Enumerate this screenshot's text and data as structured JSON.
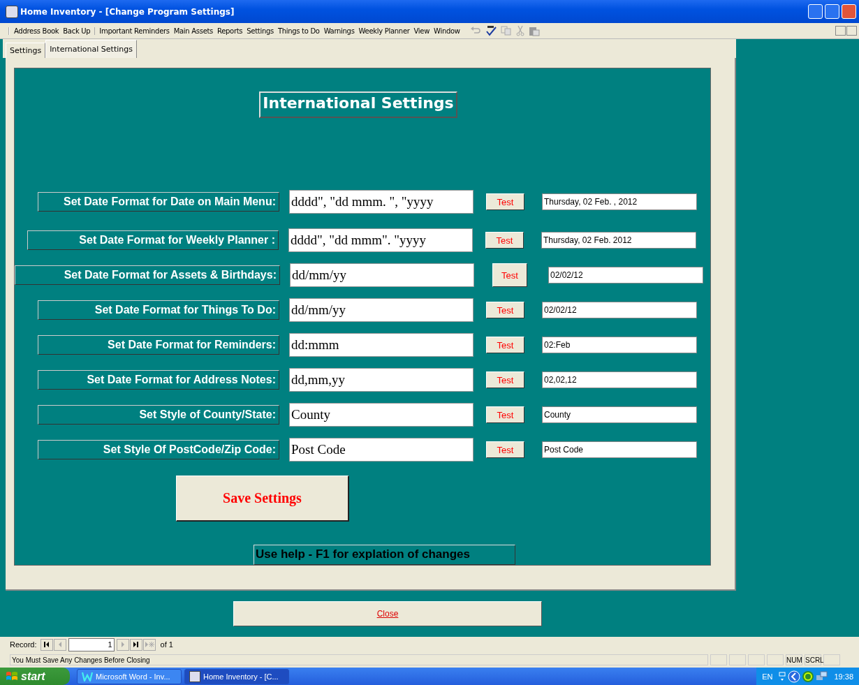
{
  "window": {
    "title": "Home Inventory - [Change Program Settings]"
  },
  "menu_groups": [
    [
      "Address Book",
      "Back Up"
    ],
    [
      "Important Reminders",
      "Main Assets",
      "Reports",
      "Settings",
      "Things to Do",
      "Warnings",
      "Weekly Planner",
      "View",
      "Window"
    ]
  ],
  "tabs": [
    {
      "label": "Settings",
      "selected": false
    },
    {
      "label": "International Settings",
      "selected": true
    }
  ],
  "heading": "International Settings",
  "rows": [
    {
      "label": "Set Date Format for  Date on Main Menu:",
      "format": "dddd\", \"dd mmm. \", \"yyyy",
      "test": "Test",
      "result": "Thursday, 02 Feb. , 2012"
    },
    {
      "label": "Set Date Format for Weekly Planner :",
      "format": "dddd\", \"dd mmm\". \"yyyy",
      "test": "Test",
      "result": "Thursday, 02 Feb. 2012"
    },
    {
      "label": "Set Date Format for Assets & Birthdays:",
      "format": "dd/mm/yy",
      "test": "Test",
      "result": "02/02/12"
    },
    {
      "label": "Set Date Format for Things To Do:",
      "format": "dd/mm/yy",
      "test": "Test",
      "result": "02/02/12"
    },
    {
      "label": "Set Date Format for Reminders:",
      "format": "dd:mmm",
      "test": "Test",
      "result": "02:Feb"
    },
    {
      "label": "Set Date Format for Address Notes:",
      "format": "dd,mm,yy",
      "test": "Test",
      "result": "02,02,12"
    },
    {
      "label": "Set Style of County/State:",
      "format": "County",
      "test": "Test",
      "result": "County"
    },
    {
      "label": "Set Style Of PostCode/Zip Code:",
      "format": "Post Code",
      "test": "Test",
      "result": "Post Code"
    }
  ],
  "save_button": "Save Settings",
  "help_note": "Use help  - F1 for explation of changes",
  "close_button": "Close",
  "record_nav": {
    "label": "Record:",
    "value": "1",
    "of": "of 1"
  },
  "status_bar": {
    "message": "You Must Save Any Changes Before Closing",
    "indicators": [
      "NUM",
      "SCRL"
    ]
  },
  "taskbar": {
    "start": "start",
    "tasks": [
      {
        "label": "Microsoft Word - Inv...",
        "selected": false
      },
      {
        "label": "Home Inventory - [C...",
        "selected": true
      }
    ],
    "language": "EN",
    "time": "19:38"
  }
}
